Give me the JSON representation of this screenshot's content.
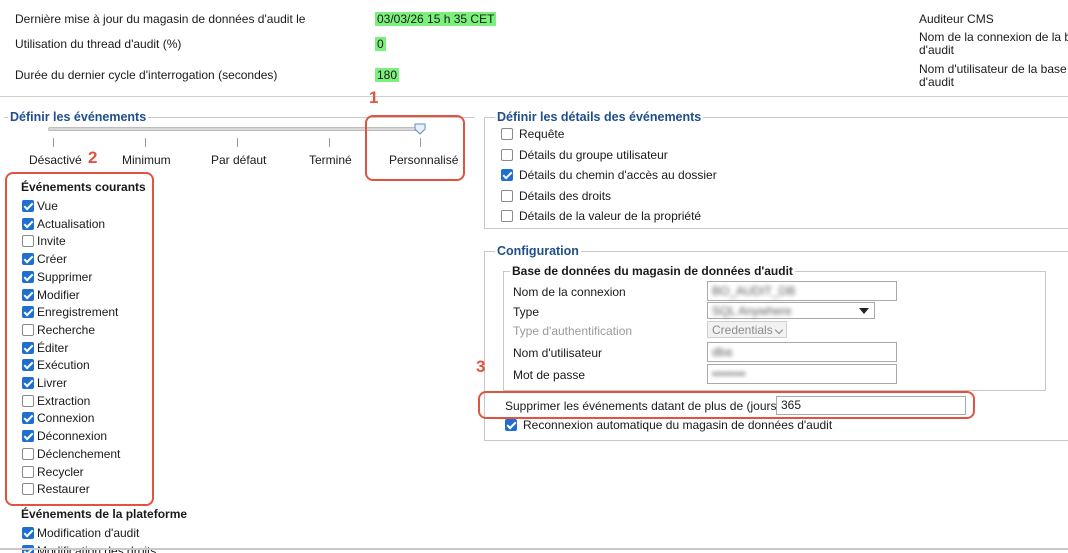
{
  "status": {
    "last_update_label": "Dernière mise à jour du magasin de données d'audit le",
    "last_update_value": "03/03/26 15 h 35 CET",
    "thread_usage_label": "Utilisation du thread d'audit (%)",
    "thread_usage_value": "0",
    "poll_cycle_label": "Durée du dernier cycle d'interrogation (secondes)",
    "poll_cycle_value": "180",
    "right_lines": [
      "Auditeur CMS",
      "Nom de la connexion de la b",
      "d'audit",
      "Nom d'utilisateur de la base",
      "d'audit"
    ]
  },
  "events": {
    "title": "Définir les événements",
    "slider_levels": [
      "Désactivé",
      "Minimum",
      "Par défaut",
      "Terminé",
      "Personnalisé"
    ],
    "slider_selected_index": 4,
    "current_title": "Événements courants",
    "current": [
      {
        "label": "Vue",
        "checked": true
      },
      {
        "label": "Actualisation",
        "checked": true
      },
      {
        "label": "Invite",
        "checked": false
      },
      {
        "label": "Créer",
        "checked": true
      },
      {
        "label": "Supprimer",
        "checked": true
      },
      {
        "label": "Modifier",
        "checked": true
      },
      {
        "label": "Enregistrement",
        "checked": true
      },
      {
        "label": "Recherche",
        "checked": false
      },
      {
        "label": "Éditer",
        "checked": true
      },
      {
        "label": "Exécution",
        "checked": true
      },
      {
        "label": "Livrer",
        "checked": true
      },
      {
        "label": "Extraction",
        "checked": false
      },
      {
        "label": "Connexion",
        "checked": true
      },
      {
        "label": "Déconnexion",
        "checked": true
      },
      {
        "label": "Déclenchement",
        "checked": false
      },
      {
        "label": "Recycler",
        "checked": false
      },
      {
        "label": "Restaurer",
        "checked": false
      }
    ],
    "platform_title": "Événements de la plateforme",
    "platform": [
      {
        "label": "Modification d'audit",
        "checked": true
      },
      {
        "label": "Modification des droits",
        "checked": true
      }
    ]
  },
  "details": {
    "title": "Définir les détails des événements",
    "items": [
      {
        "label": "Requête",
        "checked": false
      },
      {
        "label": "Détails du groupe utilisateur",
        "checked": false
      },
      {
        "label": "Détails du chemin d'accès au dossier",
        "checked": true
      },
      {
        "label": "Détails des droits",
        "checked": false
      },
      {
        "label": "Détails de la valeur de la propriété",
        "checked": false
      }
    ]
  },
  "config": {
    "title": "Configuration",
    "db_title": "Base de données du magasin de données d'audit",
    "connection_label": "Nom de la connexion",
    "connection_value": "BO_AUDIT_DB",
    "type_label": "Type",
    "type_value": "SQL Anywhere",
    "auth_label": "Type d'authentification",
    "auth_value": "Credentials",
    "user_label": "Nom d'utilisateur",
    "user_value": "dba",
    "password_label": "Mot de passe",
    "password_value": "••••••••",
    "purge_label": "Supprimer les événements datant de plus de (jours)",
    "purge_value": "365",
    "reconnect_label": "Reconnexion automatique du magasin de données d'audit",
    "reconnect_checked": true
  },
  "annotations": {
    "n1": "1",
    "n2": "2",
    "n3": "3"
  },
  "colors": {
    "accent": "#1f6fd0",
    "title_blue": "#1f4e8c",
    "highlight": "#7cf07c",
    "callout": "#e0533f"
  }
}
